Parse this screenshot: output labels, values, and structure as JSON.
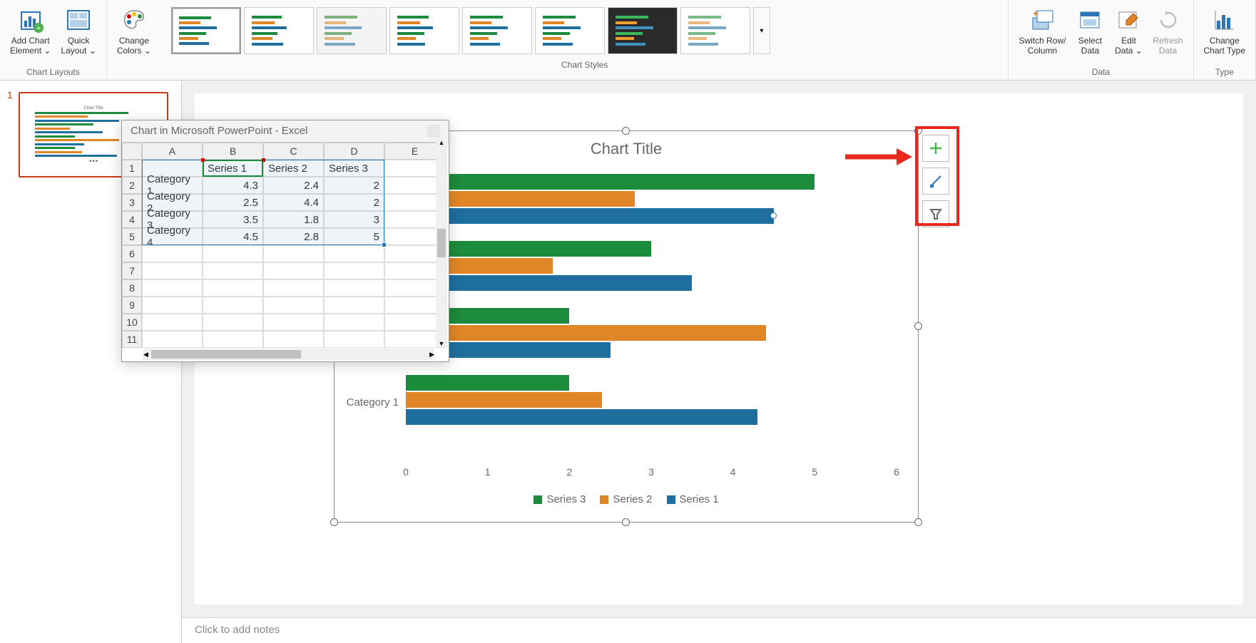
{
  "ribbon": {
    "groups": {
      "layouts": {
        "label": "Chart Layouts",
        "add_element": "Add Chart\nElement ⌄",
        "quick_layout": "Quick\nLayout ⌄"
      },
      "colors": {
        "change_colors": "Change\nColors ⌄"
      },
      "styles": {
        "label": "Chart Styles"
      },
      "data": {
        "label": "Data",
        "switch": "Switch Row/\nColumn",
        "select": "Select\nData",
        "edit": "Edit\nData ⌄",
        "refresh": "Refresh\nData"
      },
      "type": {
        "label": "Type",
        "change_type": "Change\nChart Type"
      }
    }
  },
  "thumb": {
    "slide_number": "1"
  },
  "notes": "Click to add notes",
  "excel": {
    "title": "Chart in Microsoft PowerPoint - Excel",
    "cols": [
      "A",
      "B",
      "C",
      "D",
      "E"
    ],
    "headers": [
      "",
      "Series 1",
      "Series 2",
      "Series 3",
      ""
    ],
    "rows": [
      {
        "label": "Category 1",
        "vals": [
          "4.3",
          "2.4",
          "2",
          ""
        ]
      },
      {
        "label": "Category 2",
        "vals": [
          "2.5",
          "4.4",
          "2",
          ""
        ]
      },
      {
        "label": "Category 3",
        "vals": [
          "3.5",
          "1.8",
          "3",
          ""
        ]
      },
      {
        "label": "Category 4",
        "vals": [
          "4.5",
          "2.8",
          "5",
          ""
        ]
      }
    ]
  },
  "chart_data": {
    "type": "bar",
    "title": "Chart Title",
    "categories": [
      "Category 1",
      "Category 2",
      "Category 3",
      "Category 4"
    ],
    "series": [
      {
        "name": "Series 1",
        "color": "#1f6f9e",
        "values": [
          4.3,
          2.5,
          3.5,
          4.5
        ]
      },
      {
        "name": "Series 2",
        "color": "#e08626",
        "values": [
          2.4,
          4.4,
          1.8,
          2.8
        ]
      },
      {
        "name": "Series 3",
        "color": "#1d8b3c",
        "values": [
          2,
          2,
          3,
          5
        ]
      }
    ],
    "xlabel": "",
    "ylabel": "",
    "xlim": [
      0,
      6
    ],
    "ticks": [
      0,
      1,
      2,
      3,
      4,
      5,
      6
    ],
    "legend_order": [
      "Series 3",
      "Series 2",
      "Series 1"
    ]
  }
}
